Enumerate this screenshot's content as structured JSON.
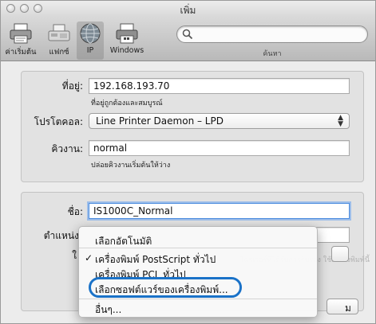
{
  "window": {
    "title": "เพิ่ม"
  },
  "toolbar": {
    "items": [
      {
        "label": "ค่าเริ่มต้น",
        "icon": "default-printer-icon"
      },
      {
        "label": "แฟกซ์",
        "icon": "fax-icon"
      },
      {
        "label": "IP",
        "icon": "ip-globe-icon",
        "selected": true
      },
      {
        "label": "Windows",
        "icon": "windows-printer-icon"
      }
    ],
    "search_label": "ค้นหา",
    "search_placeholder": ""
  },
  "form": {
    "address_label": "ที่อยู่:",
    "address_value": "192.168.193.70",
    "address_hint": "ที่อยู่ถูกต้องและสมบูรณ์",
    "protocol_label": "โปรโตคอล:",
    "protocol_value": "Line Printer Daemon – LPD",
    "queue_label": "คิวงาน:",
    "queue_value": "normal",
    "queue_hint": "ปล่อยคิวงานเริ่มต้นให้ว่าง",
    "name_label": "ชื่อ:",
    "name_value": "IS1000C_Normal",
    "location_label": "ตำแหน่ง",
    "use_label": "ใ",
    "use_faded_text": "ไดรเวอร์ที่ได้รับการรับรอง ใช้เครื่องพิมพ์นี้",
    "edge_button_label": "ม"
  },
  "menu": {
    "items": [
      {
        "label": "เลือกอัตโนมัติ",
        "checked": false
      },
      {
        "label": "เครื่องพิมพ์ PostScript ทั่วไป",
        "checked": true
      },
      {
        "label": "เครื่องพิมพ์ PCL ทั่วไป",
        "checked": false
      },
      {
        "label": "เลือกซอฟต์แวร์ของเครื่องพิมพ์...",
        "checked": false,
        "highlighted": true
      },
      {
        "label": "อื่นๆ...",
        "checked": false
      }
    ],
    "check_glyph": "✓"
  },
  "colors": {
    "highlight_oval": "#1a72c8",
    "focus_ring": "#4d8ddf"
  }
}
